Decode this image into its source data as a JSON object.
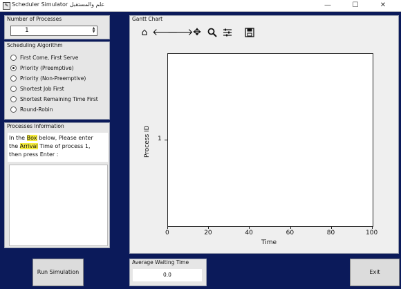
{
  "window": {
    "title": "Scheduler Simulator  علم والمستقبل",
    "minimize": "—",
    "maximize": "☐",
    "close": "✕"
  },
  "num_processes": {
    "label": "Number of Processes",
    "value": "1"
  },
  "scheduling": {
    "label": "Scheduling Algorithm",
    "options": [
      {
        "label": "First Come, First Serve",
        "checked": false
      },
      {
        "label": "Priority (Preemptive)",
        "checked": true
      },
      {
        "label": "Priority (Non-Preemptive)",
        "checked": false
      },
      {
        "label": "Shortest Job First",
        "checked": false
      },
      {
        "label": "Shortest Remaining Time First",
        "checked": false
      },
      {
        "label": "Round-Robin",
        "checked": false
      }
    ]
  },
  "processes_info": {
    "label": "Processes Information",
    "line1_a": "In the ",
    "line1_hl": "Box",
    "line1_b": " below, Please enter",
    "line2_a": "the ",
    "line2_hl": "Arrival",
    "line2_b": " Time of process 1,",
    "line3": "then press Enter :"
  },
  "run_button": "Run Simulation",
  "gantt": {
    "label": "Gantt Chart",
    "toolbar": [
      "home-icon",
      "back-arrow-icon",
      "forward-arrow-icon",
      "pan-icon",
      "zoom-icon",
      "configure-icon",
      "save-icon"
    ]
  },
  "chart_data": {
    "type": "bar",
    "title": "",
    "xlabel": "Time",
    "ylabel": "Process ID",
    "xlim": [
      0,
      100
    ],
    "xticks": [
      "0",
      "20",
      "40",
      "60",
      "80",
      "100"
    ],
    "yticks": [
      "1"
    ],
    "series": []
  },
  "avg_waiting": {
    "label": "Average Waiting Time",
    "value": "0.0"
  },
  "exit_button": "Exit"
}
